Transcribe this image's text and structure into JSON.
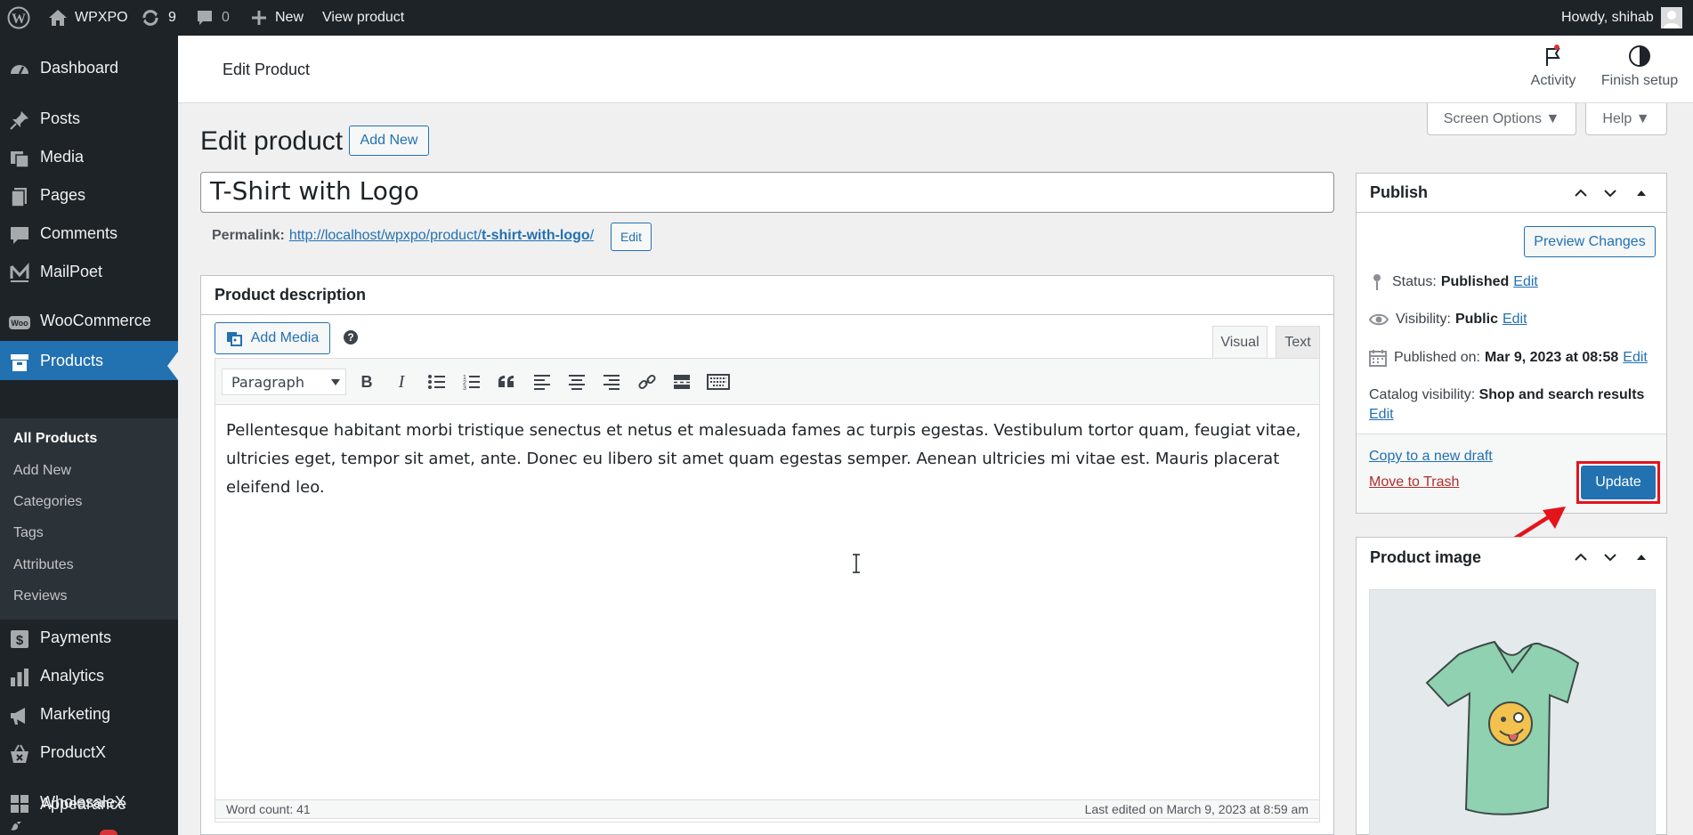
{
  "admin_bar": {
    "site_name": "WPXPO",
    "updates_count": "9",
    "comments_count": "0",
    "new_label": "New",
    "view_label": "View product",
    "howdy": "Howdy, shihab"
  },
  "sidebar": {
    "items": [
      {
        "label": "Dashboard",
        "icon": "dashboard-icon"
      },
      {
        "label": "Posts",
        "icon": "pin-icon"
      },
      {
        "label": "Media",
        "icon": "media-icon"
      },
      {
        "label": "Pages",
        "icon": "pages-icon"
      },
      {
        "label": "Comments",
        "icon": "comment-icon"
      },
      {
        "label": "MailPoet",
        "icon": "mailpoet-icon"
      },
      {
        "label": "WooCommerce",
        "icon": "woo-icon"
      },
      {
        "label": "Products",
        "icon": "archive-icon"
      },
      {
        "label": "Payments",
        "icon": "payments-icon"
      },
      {
        "label": "Analytics",
        "icon": "analytics-icon"
      },
      {
        "label": "Marketing",
        "icon": "megaphone-icon"
      },
      {
        "label": "ProductX",
        "icon": "basket-icon"
      },
      {
        "label": "WholesaleX",
        "icon": "grid-icon"
      },
      {
        "label": "Appearance",
        "icon": "brush-icon"
      }
    ],
    "submenu": [
      "All Products",
      "Add New",
      "Categories",
      "Tags",
      "Attributes",
      "Reviews"
    ]
  },
  "header": {
    "title": "Edit Product",
    "activity": "Activity",
    "finish_setup": "Finish setup"
  },
  "screen_options": "Screen Options ▼",
  "help": "Help ▼",
  "page": {
    "heading": "Edit product",
    "add_new": "Add New",
    "title_value": "T-Shirt with Logo",
    "permalink_label": "Permalink:",
    "permalink_base": "http://localhost/wpxpo/product/",
    "permalink_slug": "t-shirt-with-logo",
    "permalink_trail": "/",
    "permalink_edit": "Edit"
  },
  "description_box": {
    "title": "Product description",
    "add_media": "Add Media",
    "tab_visual": "Visual",
    "tab_text": "Text",
    "format_select": "Paragraph",
    "content": "Pellentesque habitant morbi tristique senectus et netus et malesuada fames ac turpis egestas. Vestibulum tortor quam, feugiat vitae, ultricies eget, tempor sit amet, ante. Donec eu libero sit amet quam egestas semper. Aenean ultricies mi vitae est. Mauris placerat eleifend leo.",
    "word_count": "Word count: 41",
    "last_edited": "Last edited on March 9, 2023 at 8:59 am"
  },
  "publish_box": {
    "title": "Publish",
    "preview": "Preview Changes",
    "status_label": "Status:",
    "status_value": "Published",
    "visibility_label": "Visibility:",
    "visibility_value": "Public",
    "published_label": "Published on:",
    "published_value": "Mar 9, 2023 at 08:58",
    "catalog_label": "Catalog visibility:",
    "catalog_value": "Shop and search results",
    "edit": "Edit",
    "copy_draft": "Copy to a new draft",
    "trash": "Move to Trash",
    "update": "Update"
  },
  "product_image_box": {
    "title": "Product image"
  },
  "colors": {
    "accent": "#2271b1",
    "admin_dark": "#1d2327",
    "highlight_red": "#e3141b"
  }
}
